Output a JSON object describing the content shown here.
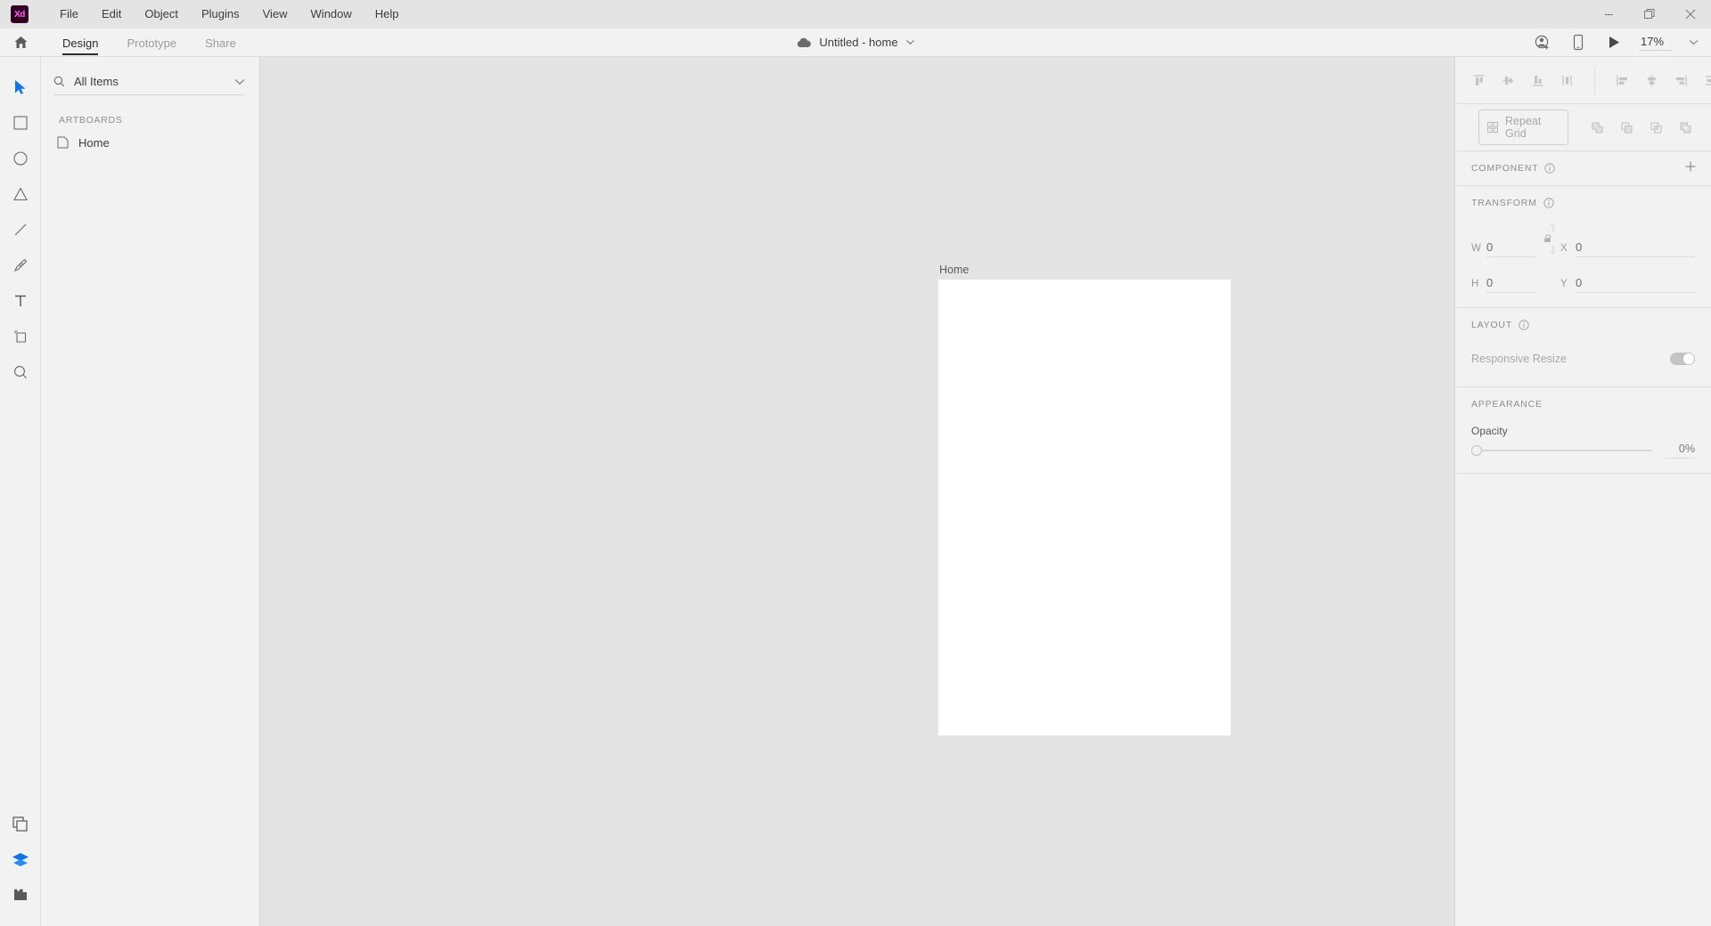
{
  "app": {
    "logo_text": "Xd",
    "menus": [
      "File",
      "Edit",
      "Object",
      "Plugins",
      "View",
      "Window",
      "Help"
    ]
  },
  "window_controls": {
    "minimize": "minimize-icon",
    "maximize": "restore-icon",
    "close": "close-icon"
  },
  "appbar": {
    "home_icon": "home-icon",
    "tabs": [
      {
        "label": "Design",
        "active": true
      },
      {
        "label": "Prototype",
        "active": false
      },
      {
        "label": "Share",
        "active": false
      }
    ],
    "document": {
      "cloud_icon": "cloud-icon",
      "title": "Untitled - home",
      "chevron": "chevron-down-icon"
    },
    "invite_icon": "invite-user-icon",
    "device_icon": "device-preview-icon",
    "play_icon": "play-preview-icon",
    "zoom_value": "17%",
    "zoom_chevron": "chevron-down-icon"
  },
  "toolbar": {
    "tools": [
      {
        "name": "select-tool",
        "icon": "cursor-icon",
        "active": true
      },
      {
        "name": "rectangle-tool",
        "icon": "rectangle-icon",
        "active": false
      },
      {
        "name": "ellipse-tool",
        "icon": "ellipse-icon",
        "active": false
      },
      {
        "name": "polygon-tool",
        "icon": "triangle-icon",
        "active": false
      },
      {
        "name": "line-tool",
        "icon": "line-icon",
        "active": false
      },
      {
        "name": "pen-tool",
        "icon": "pen-icon",
        "active": false
      },
      {
        "name": "text-tool",
        "icon": "text-icon",
        "active": false
      },
      {
        "name": "artboard-tool",
        "icon": "artboard-icon",
        "active": false
      },
      {
        "name": "zoom-tool",
        "icon": "magnifier-icon",
        "active": false
      }
    ],
    "bottom_tools": [
      {
        "name": "assets-panel-button",
        "icon": "assets-icon",
        "active": false
      },
      {
        "name": "layers-panel-button",
        "icon": "layers-icon",
        "active": true
      },
      {
        "name": "plugins-panel-button",
        "icon": "plugins-icon",
        "active": false
      }
    ]
  },
  "layers": {
    "search_icon": "search-icon",
    "filter_label": "All Items",
    "chevron": "chevron-down-icon",
    "section_label": "ARTBOARDS",
    "items": [
      {
        "icon": "artboard-item-icon",
        "name": "Home"
      }
    ]
  },
  "canvas": {
    "artboard_label": "Home",
    "artboard_fill": "#ffffff",
    "background": "#e4e4e4"
  },
  "properties": {
    "align_vertical": [
      {
        "name": "align-top-button",
        "icon": "align-top-icon"
      },
      {
        "name": "align-vertical-center-button",
        "icon": "align-vertical-center-icon"
      },
      {
        "name": "align-bottom-button",
        "icon": "align-bottom-icon"
      },
      {
        "name": "distribute-vertical-button",
        "icon": "distribute-vertical-icon"
      }
    ],
    "align_horizontal": [
      {
        "name": "align-left-button",
        "icon": "align-left-icon"
      },
      {
        "name": "align-horizontal-center-button",
        "icon": "align-horizontal-center-icon"
      },
      {
        "name": "align-right-button",
        "icon": "align-right-icon"
      },
      {
        "name": "distribute-horizontal-button",
        "icon": "distribute-horizontal-icon"
      }
    ],
    "repeat_grid": {
      "icon": "repeat-grid-icon",
      "label": "Repeat Grid"
    },
    "boolean_ops": [
      {
        "name": "add-boolean-button",
        "icon": "boolean-union-icon"
      },
      {
        "name": "subtract-boolean-button",
        "icon": "boolean-subtract-icon"
      },
      {
        "name": "intersect-boolean-button",
        "icon": "boolean-intersect-icon"
      },
      {
        "name": "exclude-boolean-button",
        "icon": "boolean-exclude-icon"
      }
    ],
    "component": {
      "title": "COMPONENT",
      "info_icon": "info-icon",
      "add_icon": "plus-icon"
    },
    "transform": {
      "title": "TRANSFORM",
      "info_icon": "info-icon",
      "w_label": "W",
      "w_value": "0",
      "h_label": "H",
      "h_value": "0",
      "x_label": "X",
      "x_value": "0",
      "y_label": "Y",
      "y_value": "0",
      "lock_icon": "unlock-aspect-ratio-icon"
    },
    "layout": {
      "title": "LAYOUT",
      "info_icon": "info-icon",
      "responsive_label": "Responsive Resize",
      "responsive_enabled": true
    },
    "appearance": {
      "title": "APPEARANCE",
      "opacity_label": "Opacity",
      "opacity_value": "0%"
    }
  }
}
